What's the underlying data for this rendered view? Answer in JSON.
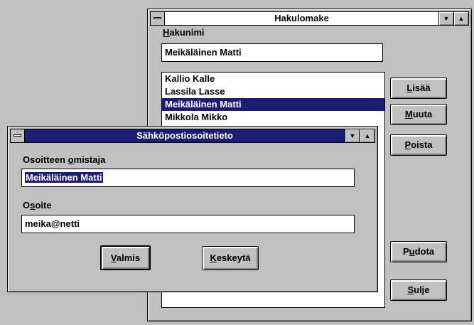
{
  "hakulomake": {
    "title": "Hakulomake",
    "search_label_prefix": "",
    "search_label_accel": "H",
    "search_label_rest": "akunimi",
    "search_value": "Meikäläinen Matti",
    "list_items": [
      "Kallio Kalle",
      "Lassila Lasse",
      "Meikäläinen Matti",
      "Mikkola Mikko"
    ],
    "selected_index": 2,
    "buttons": {
      "add": {
        "pre": "",
        "accel": "L",
        "post": "isää"
      },
      "edit": {
        "pre": "",
        "accel": "M",
        "post": "uuta"
      },
      "delete": {
        "pre": "",
        "accel": "P",
        "post": "oista"
      },
      "drop": {
        "pre": "P",
        "accel": "u",
        "post": "dota"
      },
      "close": {
        "pre": "",
        "accel": "S",
        "post": "ulje"
      }
    }
  },
  "dialog": {
    "title": "Sähköpostiosoitetieto",
    "owner_label": {
      "pre": "Osoitteen ",
      "accel": "o",
      "post": "mistaja"
    },
    "owner_value": "Meikäläinen Matti",
    "address_label": {
      "pre": "O",
      "accel": "s",
      "post": "oite"
    },
    "address_value": "meika@netti",
    "ok_button": {
      "pre": "",
      "accel": "V",
      "post": "almis"
    },
    "cancel_button": {
      "pre": "",
      "accel": "K",
      "post": "eskeytä"
    }
  },
  "colors": {
    "selection": "#1c1c72",
    "face": "#c0c0c0"
  }
}
